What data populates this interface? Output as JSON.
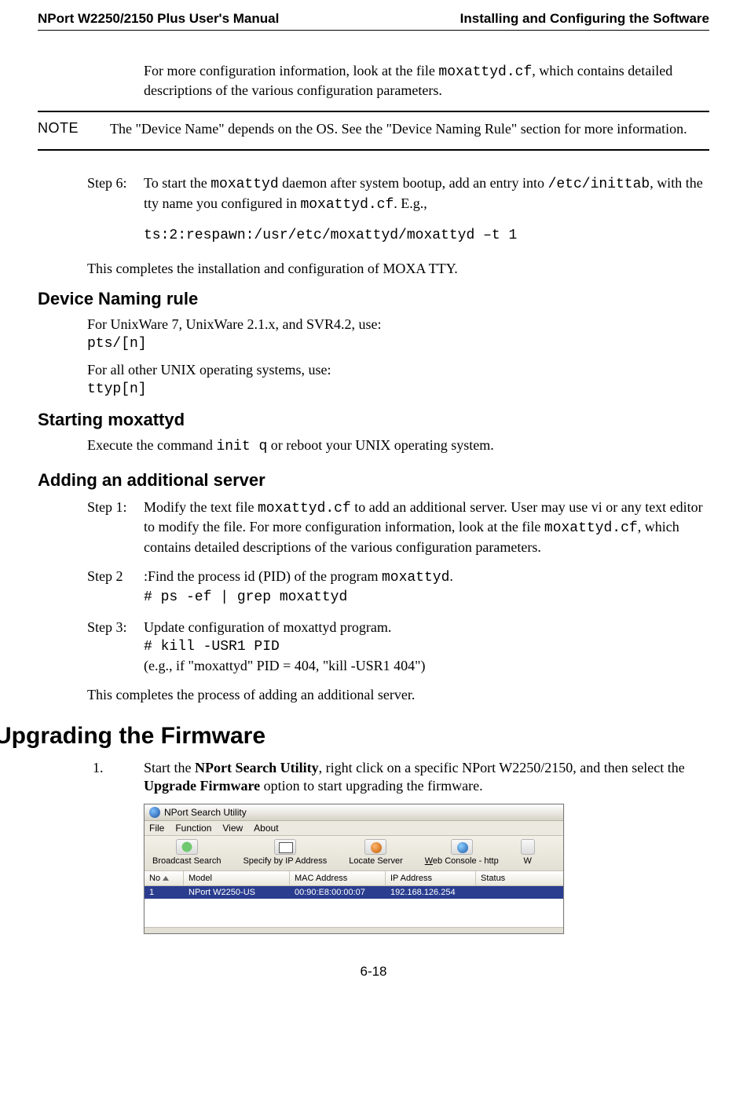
{
  "header": {
    "left": "NPort W2250/2150 Plus User's Manual",
    "right": "Installing and Configuring the Software"
  },
  "intro": {
    "p1a": "For more configuration information, look at the file ",
    "p1_code": "moxattyd.cf",
    "p1b": ", which contains detailed descriptions of the various configuration parameters."
  },
  "note": {
    "label": "NOTE",
    "text": "The \"Device Name\" depends on the OS. See the \"Device Naming Rule\" section for more information."
  },
  "step6": {
    "label": "Step 6:",
    "t1": "To start the ",
    "c1": "moxattyd",
    "t2": " daemon after system bootup, add an entry into ",
    "c2": "/etc/inittab",
    "t3": ", with the tty name you configured in ",
    "c3": "moxattyd.cf",
    "t4": ". E.g.,",
    "cmd": "ts:2:respawn:/usr/etc/moxattyd/moxattyd –t 1"
  },
  "complete1": "This completes the installation and configuration of MOXA TTY.",
  "headings": {
    "naming": "Device Naming rule",
    "starting": "Starting moxattyd",
    "adding": "Adding an additional server",
    "upgrading": "Upgrading the Firmware"
  },
  "naming": {
    "p1": "For UnixWare 7, UnixWare 2.1.x, and SVR4.2, use:",
    "c1": "pts/[n]",
    "p2": "For all other UNIX operating systems, use:",
    "c2": "ttyp[n]"
  },
  "starting": {
    "t1": "Execute the command ",
    "c1": "init q",
    "t2": " or reboot your UNIX operating system."
  },
  "adding": {
    "s1": {
      "label": "Step 1:",
      "t1": "Modify the text file ",
      "c1": "moxattyd.cf",
      "t2": " to add an additional server. User may use vi or any text editor to modify the file. For more configuration information, look at the file ",
      "c2": "moxattyd.cf",
      "t3": ", which contains detailed descriptions of the various configuration parameters."
    },
    "s2": {
      "label": "Step 2",
      "colon": ":",
      "t1": "Find the process id (PID) of the program ",
      "c1": "moxattyd",
      "t2": ".",
      "cmd": "# ps -ef | grep moxattyd"
    },
    "s3": {
      "label": "Step 3:",
      "t1": "Update configuration of moxattyd program.",
      "cmd": "# kill -USR1 PID",
      "t2": "(e.g., if \"moxattyd\" PID = 404, \"kill -USR1 404\")"
    },
    "done": "This completes the process of adding an additional server."
  },
  "upgrading": {
    "num": "1.",
    "t1": "Start the ",
    "b1": "NPort Search Utility",
    "t2": ", right click on a specific NPort W2250/2150, and then select the ",
    "b2": "Upgrade Firmware",
    "t3": " option to start upgrading the firmware."
  },
  "screenshot": {
    "title": "NPort Search Utility",
    "menu": {
      "file": "File",
      "func": "Function",
      "view": "View",
      "about": "About"
    },
    "toolbar": {
      "bsearch": "Broadcast Search",
      "specify": "Specify by IP Address",
      "locate": "Locate Server",
      "web_u": "W",
      "web_rest": "eb Console - http",
      "extra": "W"
    },
    "cols": {
      "no": "No",
      "model": "Model",
      "mac": "MAC Address",
      "ip": "IP Address",
      "status": "Status"
    },
    "row": {
      "no": "1",
      "model": "NPort W2250-US",
      "mac": "00:90:E8:00:00:07",
      "ip": "192.168.126.254",
      "status": ""
    }
  },
  "pagefoot": "6-18"
}
